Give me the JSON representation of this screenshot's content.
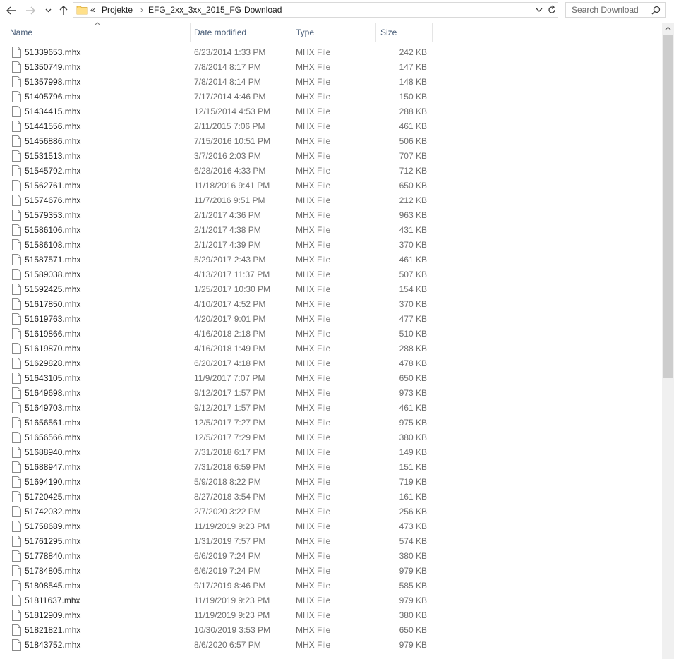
{
  "navigation": {
    "back_icon": "arrow-left-icon",
    "forward_icon": "arrow-right-icon",
    "recent_icon": "chevron-down-icon",
    "up_icon": "arrow-up-icon"
  },
  "address_bar": {
    "overflow": "«",
    "separator": "›",
    "path": [
      "Projekte",
      "EFG_2xx_3xx_2015_FG",
      "Download"
    ]
  },
  "search": {
    "placeholder": "Search Download"
  },
  "columns": {
    "name": "Name",
    "date": "Date modified",
    "type": "Type",
    "size": "Size"
  },
  "files": [
    {
      "name": "51339653.mhx",
      "date": "6/23/2014 1:33 PM",
      "type": "MHX File",
      "size": "242 KB"
    },
    {
      "name": "51350749.mhx",
      "date": "7/8/2014 8:17 PM",
      "type": "MHX File",
      "size": "147 KB"
    },
    {
      "name": "51357998.mhx",
      "date": "7/8/2014 8:14 PM",
      "type": "MHX File",
      "size": "148 KB"
    },
    {
      "name": "51405796.mhx",
      "date": "7/17/2014 4:46 PM",
      "type": "MHX File",
      "size": "150 KB"
    },
    {
      "name": "51434415.mhx",
      "date": "12/15/2014 4:53 PM",
      "type": "MHX File",
      "size": "288 KB"
    },
    {
      "name": "51441556.mhx",
      "date": "2/11/2015 7:06 PM",
      "type": "MHX File",
      "size": "461 KB"
    },
    {
      "name": "51456886.mhx",
      "date": "7/15/2016 10:51 PM",
      "type": "MHX File",
      "size": "506 KB"
    },
    {
      "name": "51531513.mhx",
      "date": "3/7/2016 2:03 PM",
      "type": "MHX File",
      "size": "707 KB"
    },
    {
      "name": "51545792.mhx",
      "date": "6/28/2016 4:33 PM",
      "type": "MHX File",
      "size": "712 KB"
    },
    {
      "name": "51562761.mhx",
      "date": "11/18/2016 9:41 PM",
      "type": "MHX File",
      "size": "650 KB"
    },
    {
      "name": "51574676.mhx",
      "date": "11/7/2016 9:51 PM",
      "type": "MHX File",
      "size": "212 KB"
    },
    {
      "name": "51579353.mhx",
      "date": "2/1/2017 4:36 PM",
      "type": "MHX File",
      "size": "963 KB"
    },
    {
      "name": "51586106.mhx",
      "date": "2/1/2017 4:38 PM",
      "type": "MHX File",
      "size": "431 KB"
    },
    {
      "name": "51586108.mhx",
      "date": "2/1/2017 4:39 PM",
      "type": "MHX File",
      "size": "370 KB"
    },
    {
      "name": "51587571.mhx",
      "date": "5/29/2017 2:43 PM",
      "type": "MHX File",
      "size": "461 KB"
    },
    {
      "name": "51589038.mhx",
      "date": "4/13/2017 11:37 PM",
      "type": "MHX File",
      "size": "507 KB"
    },
    {
      "name": "51592425.mhx",
      "date": "1/25/2017 10:30 PM",
      "type": "MHX File",
      "size": "154 KB"
    },
    {
      "name": "51617850.mhx",
      "date": "4/10/2017 4:52 PM",
      "type": "MHX File",
      "size": "370 KB"
    },
    {
      "name": "51619763.mhx",
      "date": "4/20/2017 9:01 PM",
      "type": "MHX File",
      "size": "477 KB"
    },
    {
      "name": "51619866.mhx",
      "date": "4/16/2018 2:18 PM",
      "type": "MHX File",
      "size": "510 KB"
    },
    {
      "name": "51619870.mhx",
      "date": "4/16/2018 1:49 PM",
      "type": "MHX File",
      "size": "288 KB"
    },
    {
      "name": "51629828.mhx",
      "date": "6/20/2017 4:18 PM",
      "type": "MHX File",
      "size": "478 KB"
    },
    {
      "name": "51643105.mhx",
      "date": "11/9/2017 7:07 PM",
      "type": "MHX File",
      "size": "650 KB"
    },
    {
      "name": "51649698.mhx",
      "date": "9/12/2017 1:57 PM",
      "type": "MHX File",
      "size": "973 KB"
    },
    {
      "name": "51649703.mhx",
      "date": "9/12/2017 1:57 PM",
      "type": "MHX File",
      "size": "461 KB"
    },
    {
      "name": "51656561.mhx",
      "date": "12/5/2017 7:27 PM",
      "type": "MHX File",
      "size": "975 KB"
    },
    {
      "name": "51656566.mhx",
      "date": "12/5/2017 7:29 PM",
      "type": "MHX File",
      "size": "380 KB"
    },
    {
      "name": "51688940.mhx",
      "date": "7/31/2018 6:17 PM",
      "type": "MHX File",
      "size": "149 KB"
    },
    {
      "name": "51688947.mhx",
      "date": "7/31/2018 6:59 PM",
      "type": "MHX File",
      "size": "151 KB"
    },
    {
      "name": "51694190.mhx",
      "date": "5/9/2018 8:22 PM",
      "type": "MHX File",
      "size": "719 KB"
    },
    {
      "name": "51720425.mhx",
      "date": "8/27/2018 3:54 PM",
      "type": "MHX File",
      "size": "161 KB"
    },
    {
      "name": "51742032.mhx",
      "date": "2/7/2020 3:22 PM",
      "type": "MHX File",
      "size": "256 KB"
    },
    {
      "name": "51758689.mhx",
      "date": "11/19/2019 9:23 PM",
      "type": "MHX File",
      "size": "473 KB"
    },
    {
      "name": "51761295.mhx",
      "date": "1/31/2019 7:57 PM",
      "type": "MHX File",
      "size": "574 KB"
    },
    {
      "name": "51778840.mhx",
      "date": "6/6/2019 7:24 PM",
      "type": "MHX File",
      "size": "380 KB"
    },
    {
      "name": "51784805.mhx",
      "date": "6/6/2019 7:24 PM",
      "type": "MHX File",
      "size": "979 KB"
    },
    {
      "name": "51808545.mhx",
      "date": "9/17/2019 8:46 PM",
      "type": "MHX File",
      "size": "585 KB"
    },
    {
      "name": "51811637.mhx",
      "date": "11/19/2019 9:23 PM",
      "type": "MHX File",
      "size": "979 KB"
    },
    {
      "name": "51812909.mhx",
      "date": "11/19/2019 9:23 PM",
      "type": "MHX File",
      "size": "380 KB"
    },
    {
      "name": "51821821.mhx",
      "date": "10/30/2019 3:53 PM",
      "type": "MHX File",
      "size": "650 KB"
    },
    {
      "name": "51843752.mhx",
      "date": "8/6/2020 6:57 PM",
      "type": "MHX File",
      "size": "979 KB"
    }
  ],
  "scrollbar": {
    "up_icon": "scroll-up-arrow-icon"
  }
}
